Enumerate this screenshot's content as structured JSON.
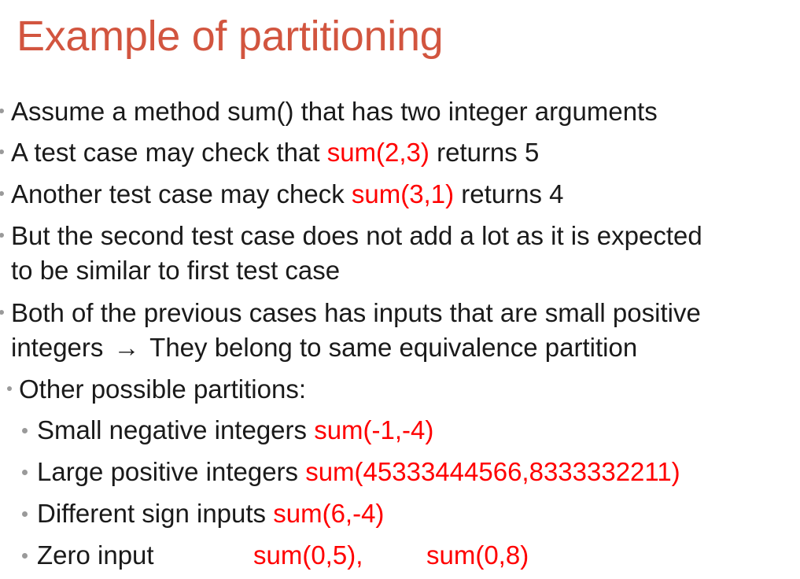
{
  "title": "Example of partitioning",
  "bullets": [
    {
      "text": "Assume a method sum() that has two integer arguments"
    },
    {
      "text": "A test case may check that ",
      "code": "sum(2,3)",
      "after": " returns 5"
    },
    {
      "text": "Another test case may check ",
      "code": "sum(3,1)",
      "after": " returns 4"
    },
    {
      "line1": "But the second test case does not add a lot as it is expected",
      "line2": "to be similar to first test case"
    },
    {
      "line1": "Both of the previous cases has inputs that are small positive",
      "line2_a": "integers",
      "arrow": "→",
      "line2_b": "They belong to same equivalence partition"
    },
    {
      "text": "Other possible partitions:"
    }
  ],
  "partitions": [
    {
      "label": "Small negative integers ",
      "code": "sum(-1,-4)"
    },
    {
      "label": "Large positive integers ",
      "code": "sum(45333444566,8333332211)"
    },
    {
      "label": "Different sign inputs ",
      "code": "sum(6,-4)"
    },
    {
      "label": "Zero input",
      "code1": "sum(0,5),",
      "code2": "sum(0,8)"
    }
  ]
}
